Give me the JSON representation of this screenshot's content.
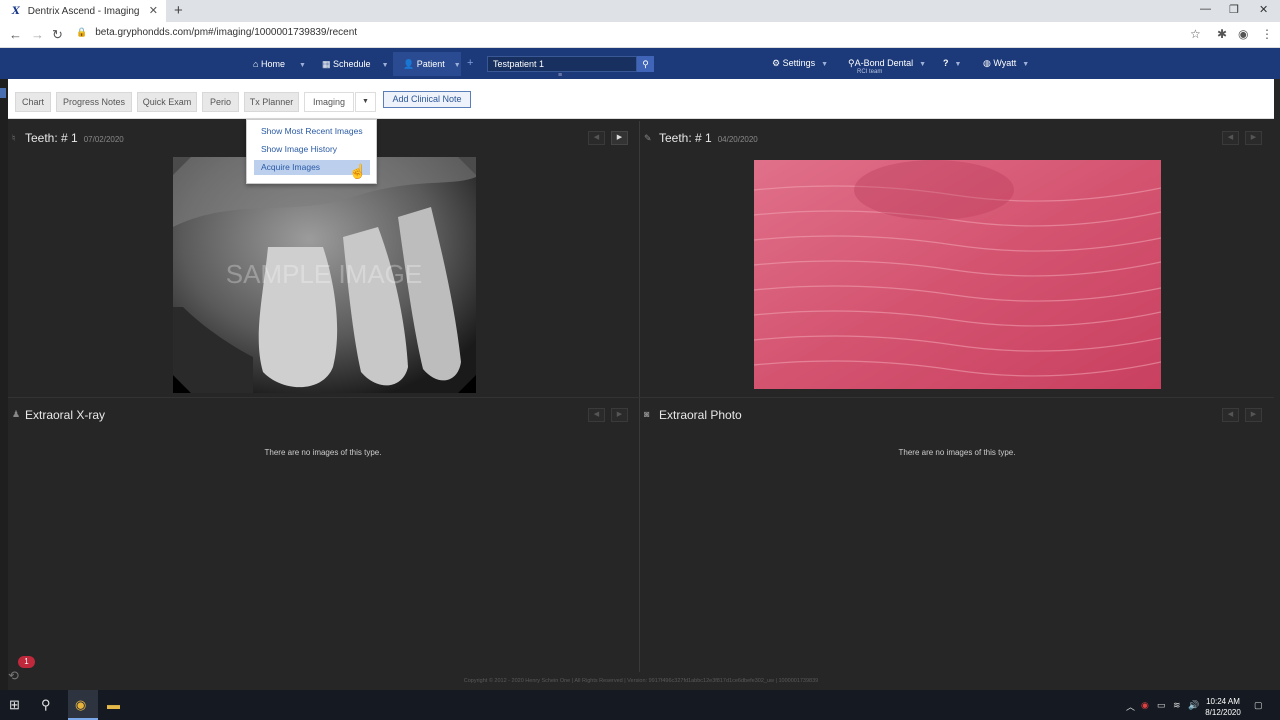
{
  "browser": {
    "tab_title": "Dentrix Ascend - Imaging",
    "favicon": "X",
    "url": "beta.gryphondds.com/pm#/imaging/1000001739839/recent"
  },
  "nav": {
    "home": "Home",
    "schedule": "Schedule",
    "patient": "Patient",
    "patient_value": "Testpatient 1",
    "settings": "Settings",
    "location": "A-Bond Dental",
    "location_sub": "RCI team",
    "help": "?",
    "user": "Wyatt"
  },
  "tabs": [
    {
      "label": "Chart"
    },
    {
      "label": "Progress Notes"
    },
    {
      "label": "Quick Exam"
    },
    {
      "label": "Perio"
    },
    {
      "label": "Tx Planner"
    },
    {
      "label": "Imaging"
    }
  ],
  "add_note": "Add Clinical Note",
  "dropdown": {
    "items": [
      "Show Most Recent Images",
      "Show Image History",
      "Acquire Images"
    ],
    "highlighted": "Acquire Images"
  },
  "panels": [
    {
      "title": "Teeth: # 1",
      "date": "07/02/2020",
      "icon": "tooth-icon"
    },
    {
      "title": "Teeth: # 1",
      "date": "04/20/2020",
      "icon": "pen-icon"
    },
    {
      "title": "Extraoral X-ray",
      "empty": "There are no images of this type.",
      "icon": "person-icon"
    },
    {
      "title": "Extraoral Photo",
      "empty": "There are no images of this type.",
      "icon": "camera-icon"
    }
  ],
  "xray_watermark": "SAMPLE IMAGE",
  "footer": "Copyright © 2012 - 2020 Henry Schein One | All Rights Reserved | Version: 9917f496c327fd1abbc12e3f817d1ce6dbefe302_uw | 1000001739839",
  "notification_count": "1",
  "clock": {
    "time": "10:24 AM",
    "date": "8/12/2020"
  },
  "colors": {
    "nav_bg": "#1c3a7a",
    "panel_bg": "#262626",
    "accent": "#2a5aa5",
    "badge": "#c0283c"
  }
}
